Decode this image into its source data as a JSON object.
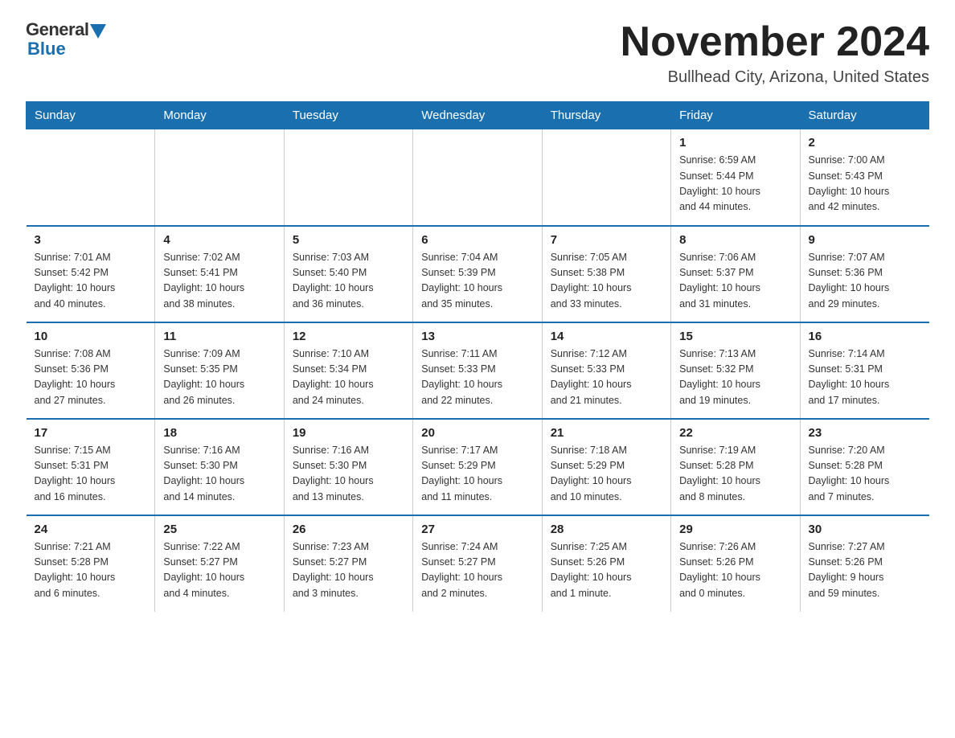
{
  "logo": {
    "general": "General",
    "blue": "Blue"
  },
  "title": "November 2024",
  "location": "Bullhead City, Arizona, United States",
  "weekdays": [
    "Sunday",
    "Monday",
    "Tuesday",
    "Wednesday",
    "Thursday",
    "Friday",
    "Saturday"
  ],
  "weeks": [
    [
      {
        "day": "",
        "info": ""
      },
      {
        "day": "",
        "info": ""
      },
      {
        "day": "",
        "info": ""
      },
      {
        "day": "",
        "info": ""
      },
      {
        "day": "",
        "info": ""
      },
      {
        "day": "1",
        "info": "Sunrise: 6:59 AM\nSunset: 5:44 PM\nDaylight: 10 hours\nand 44 minutes."
      },
      {
        "day": "2",
        "info": "Sunrise: 7:00 AM\nSunset: 5:43 PM\nDaylight: 10 hours\nand 42 minutes."
      }
    ],
    [
      {
        "day": "3",
        "info": "Sunrise: 7:01 AM\nSunset: 5:42 PM\nDaylight: 10 hours\nand 40 minutes."
      },
      {
        "day": "4",
        "info": "Sunrise: 7:02 AM\nSunset: 5:41 PM\nDaylight: 10 hours\nand 38 minutes."
      },
      {
        "day": "5",
        "info": "Sunrise: 7:03 AM\nSunset: 5:40 PM\nDaylight: 10 hours\nand 36 minutes."
      },
      {
        "day": "6",
        "info": "Sunrise: 7:04 AM\nSunset: 5:39 PM\nDaylight: 10 hours\nand 35 minutes."
      },
      {
        "day": "7",
        "info": "Sunrise: 7:05 AM\nSunset: 5:38 PM\nDaylight: 10 hours\nand 33 minutes."
      },
      {
        "day": "8",
        "info": "Sunrise: 7:06 AM\nSunset: 5:37 PM\nDaylight: 10 hours\nand 31 minutes."
      },
      {
        "day": "9",
        "info": "Sunrise: 7:07 AM\nSunset: 5:36 PM\nDaylight: 10 hours\nand 29 minutes."
      }
    ],
    [
      {
        "day": "10",
        "info": "Sunrise: 7:08 AM\nSunset: 5:36 PM\nDaylight: 10 hours\nand 27 minutes."
      },
      {
        "day": "11",
        "info": "Sunrise: 7:09 AM\nSunset: 5:35 PM\nDaylight: 10 hours\nand 26 minutes."
      },
      {
        "day": "12",
        "info": "Sunrise: 7:10 AM\nSunset: 5:34 PM\nDaylight: 10 hours\nand 24 minutes."
      },
      {
        "day": "13",
        "info": "Sunrise: 7:11 AM\nSunset: 5:33 PM\nDaylight: 10 hours\nand 22 minutes."
      },
      {
        "day": "14",
        "info": "Sunrise: 7:12 AM\nSunset: 5:33 PM\nDaylight: 10 hours\nand 21 minutes."
      },
      {
        "day": "15",
        "info": "Sunrise: 7:13 AM\nSunset: 5:32 PM\nDaylight: 10 hours\nand 19 minutes."
      },
      {
        "day": "16",
        "info": "Sunrise: 7:14 AM\nSunset: 5:31 PM\nDaylight: 10 hours\nand 17 minutes."
      }
    ],
    [
      {
        "day": "17",
        "info": "Sunrise: 7:15 AM\nSunset: 5:31 PM\nDaylight: 10 hours\nand 16 minutes."
      },
      {
        "day": "18",
        "info": "Sunrise: 7:16 AM\nSunset: 5:30 PM\nDaylight: 10 hours\nand 14 minutes."
      },
      {
        "day": "19",
        "info": "Sunrise: 7:16 AM\nSunset: 5:30 PM\nDaylight: 10 hours\nand 13 minutes."
      },
      {
        "day": "20",
        "info": "Sunrise: 7:17 AM\nSunset: 5:29 PM\nDaylight: 10 hours\nand 11 minutes."
      },
      {
        "day": "21",
        "info": "Sunrise: 7:18 AM\nSunset: 5:29 PM\nDaylight: 10 hours\nand 10 minutes."
      },
      {
        "day": "22",
        "info": "Sunrise: 7:19 AM\nSunset: 5:28 PM\nDaylight: 10 hours\nand 8 minutes."
      },
      {
        "day": "23",
        "info": "Sunrise: 7:20 AM\nSunset: 5:28 PM\nDaylight: 10 hours\nand 7 minutes."
      }
    ],
    [
      {
        "day": "24",
        "info": "Sunrise: 7:21 AM\nSunset: 5:28 PM\nDaylight: 10 hours\nand 6 minutes."
      },
      {
        "day": "25",
        "info": "Sunrise: 7:22 AM\nSunset: 5:27 PM\nDaylight: 10 hours\nand 4 minutes."
      },
      {
        "day": "26",
        "info": "Sunrise: 7:23 AM\nSunset: 5:27 PM\nDaylight: 10 hours\nand 3 minutes."
      },
      {
        "day": "27",
        "info": "Sunrise: 7:24 AM\nSunset: 5:27 PM\nDaylight: 10 hours\nand 2 minutes."
      },
      {
        "day": "28",
        "info": "Sunrise: 7:25 AM\nSunset: 5:26 PM\nDaylight: 10 hours\nand 1 minute."
      },
      {
        "day": "29",
        "info": "Sunrise: 7:26 AM\nSunset: 5:26 PM\nDaylight: 10 hours\nand 0 minutes."
      },
      {
        "day": "30",
        "info": "Sunrise: 7:27 AM\nSunset: 5:26 PM\nDaylight: 9 hours\nand 59 minutes."
      }
    ]
  ]
}
